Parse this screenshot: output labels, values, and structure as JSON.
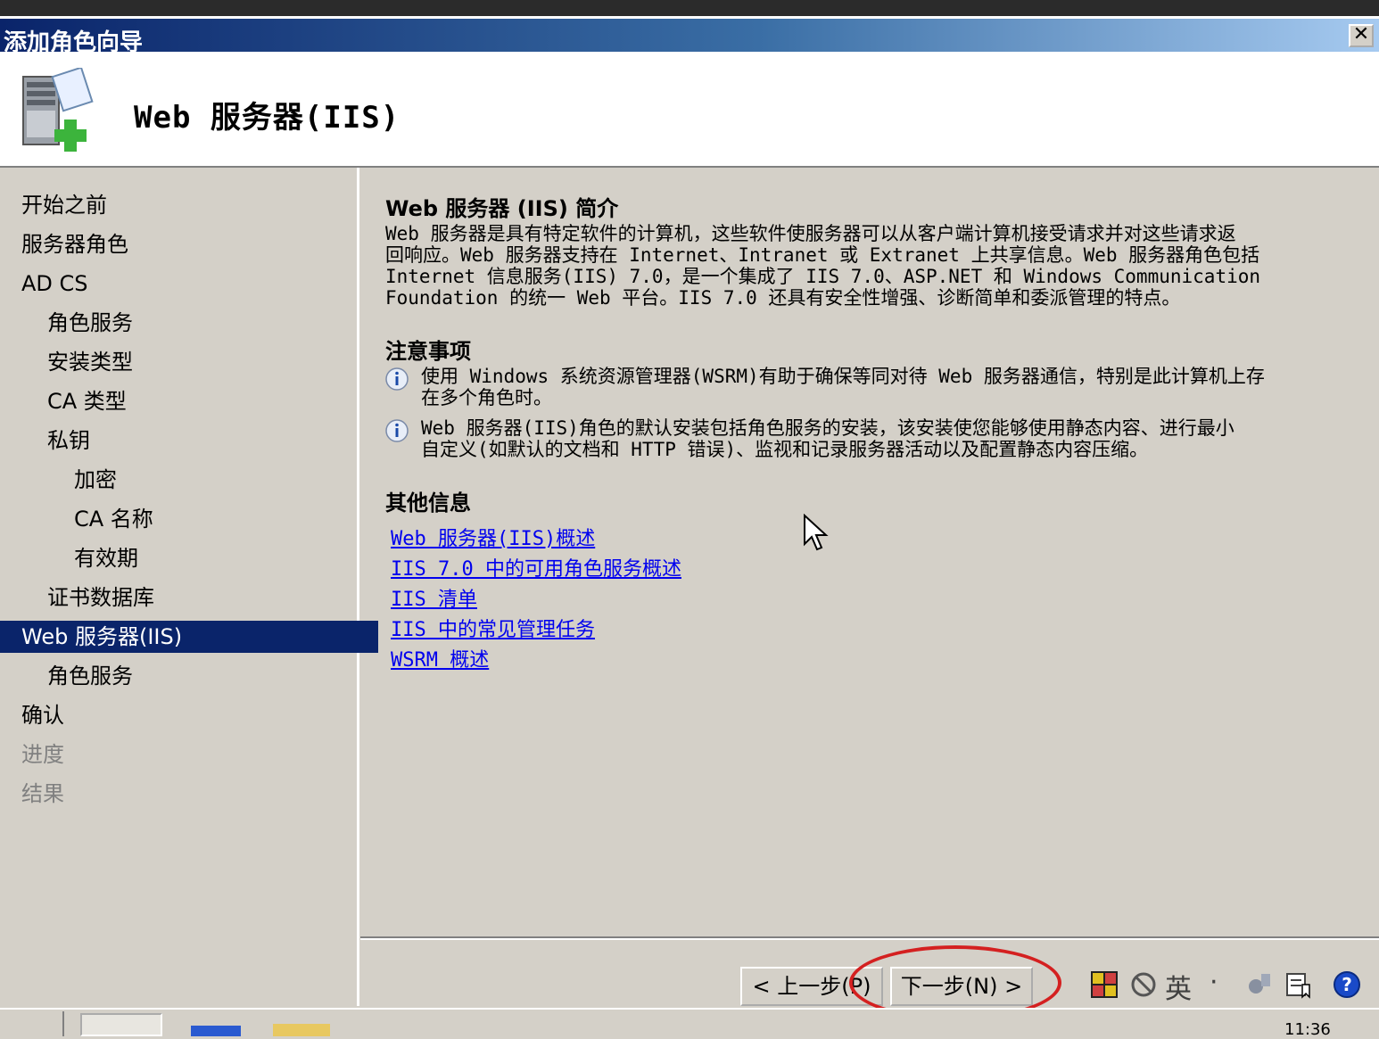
{
  "window": {
    "title": "添加角色向导",
    "close_label": "✕"
  },
  "header": {
    "title": "Web 服务器(IIS)",
    "icon": "server-add-icon"
  },
  "sidebar": {
    "items": [
      {
        "label": "开始之前",
        "level": 0,
        "state": "normal"
      },
      {
        "label": "服务器角色",
        "level": 0,
        "state": "normal"
      },
      {
        "label": "AD CS",
        "level": 0,
        "state": "normal"
      },
      {
        "label": "角色服务",
        "level": 1,
        "state": "normal"
      },
      {
        "label": "安装类型",
        "level": 1,
        "state": "normal"
      },
      {
        "label": "CA 类型",
        "level": 1,
        "state": "normal"
      },
      {
        "label": "私钥",
        "level": 1,
        "state": "normal"
      },
      {
        "label": "加密",
        "level": 2,
        "state": "normal"
      },
      {
        "label": "CA 名称",
        "level": 2,
        "state": "normal"
      },
      {
        "label": "有效期",
        "level": 2,
        "state": "normal"
      },
      {
        "label": "证书数据库",
        "level": 1,
        "state": "normal"
      },
      {
        "label": "Web 服务器(IIS)",
        "level": 0,
        "state": "active"
      },
      {
        "label": "角色服务",
        "level": 1,
        "state": "normal"
      },
      {
        "label": "确认",
        "level": 0,
        "state": "normal"
      },
      {
        "label": "进度",
        "level": 0,
        "state": "disabled"
      },
      {
        "label": "结果",
        "level": 0,
        "state": "disabled"
      }
    ]
  },
  "main": {
    "intro_title": "Web 服务器 (IIS) 简介",
    "intro_lines": [
      "Web 服务器是具有特定软件的计算机，这些软件使服务器可以从客户端计算机接受请求并对这些请求返",
      "回响应。Web 服务器支持在 Internet、Intranet 或 Extranet 上共享信息。Web 服务器角色包括",
      "Internet 信息服务(IIS) 7.0，是一个集成了 IIS 7.0、ASP.NET 和 Windows Communication",
      "Foundation 的统一 Web 平台。IIS 7.0 还具有安全性增强、诊断简单和委派管理的特点。"
    ],
    "notes_title": "注意事项",
    "notes": [
      {
        "line1": "使用 Windows 系统资源管理器(WSRM)有助于确保等同对待 Web 服务器通信，特别是此计算机上存",
        "line2": "在多个角色时。"
      },
      {
        "line1": "Web 服务器(IIS)角色的默认安装包括角色服务的安装，该安装使您能够使用静态内容、进行最小",
        "line2": "自定义(如默认的文档和 HTTP 错误)、监视和记录服务器活动以及配置静态内容压缩。"
      }
    ],
    "more_title": "其他信息",
    "links": [
      "Web 服务器(IIS)概述",
      "IIS 7.0 中的可用角色服务概述",
      "IIS 清单",
      "IIS 中的常见管理任务",
      "WSRM 概述"
    ]
  },
  "buttons": {
    "back": "< 上一步(P)",
    "next": "下一步(N) >"
  },
  "tray": {
    "ime_label": "英",
    "ime_dot": "·",
    "clock": "11:36"
  },
  "colors": {
    "title_bar": "#0a246a",
    "dialog_bg": "#d4d0c8",
    "active_item": "#0a246a",
    "link": "#0000ee",
    "highlight_circle": "#d42020"
  }
}
